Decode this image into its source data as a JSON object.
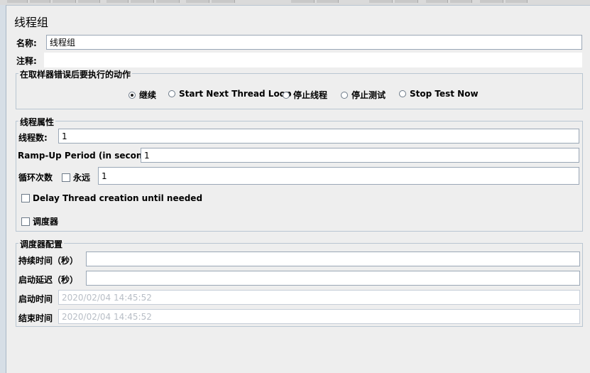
{
  "panel_title": "线程组",
  "name_field": {
    "label": "名称:",
    "value": "线程组"
  },
  "comment_field": {
    "label": "注释:",
    "value": ""
  },
  "error_action": {
    "legend": "在取样器错误后要执行的动作",
    "options": [
      {
        "label": "继续",
        "selected": true
      },
      {
        "label": "Start Next Thread Loop",
        "selected": false
      },
      {
        "label": "停止线程",
        "selected": false
      },
      {
        "label": "停止测试",
        "selected": false
      },
      {
        "label": "Stop Test Now",
        "selected": false
      }
    ]
  },
  "thread_props": {
    "legend": "线程属性",
    "num_threads": {
      "label": "线程数:",
      "value": "1"
    },
    "ramp_up": {
      "label": "Ramp-Up Period (in seconds):",
      "value": "1"
    },
    "loop": {
      "label": "循环次数",
      "forever_label": "永远",
      "forever_checked": false,
      "value": "1"
    },
    "delay_thread": {
      "label": "Delay Thread creation until needed",
      "checked": false
    },
    "scheduler": {
      "label": "调度器",
      "checked": false
    }
  },
  "scheduler_config": {
    "legend": "调度器配置",
    "duration": {
      "label": "持续时间（秒）",
      "value": ""
    },
    "startup_delay": {
      "label": "启动延迟（秒）",
      "value": ""
    },
    "start_time": {
      "label": "启动时间",
      "placeholder": "2020/02/04 14:45:52"
    },
    "end_time": {
      "label": "结束时间",
      "placeholder": "2020/02/04 14:45:52"
    }
  },
  "colors": {
    "border": "#9aa7b6",
    "background": "#eeeeee",
    "group_border": "#b9c6d2"
  }
}
